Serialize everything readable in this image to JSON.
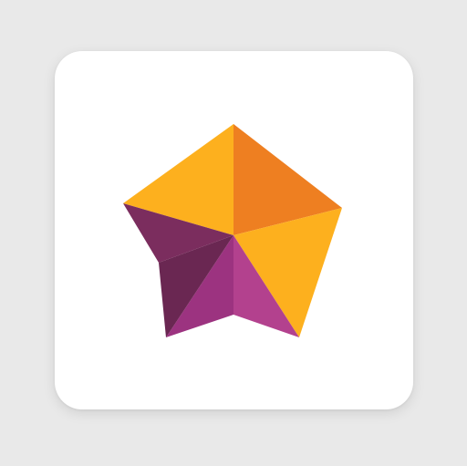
{
  "app_icon": {
    "icon": "star-logo",
    "colors": {
      "background": "#e9e9e9",
      "tile": "#ffffff",
      "orange_light": "#fdb01e",
      "orange": "#f3a019",
      "orange_dark": "#ee7f21",
      "magenta": "#b3418e",
      "magenta_dark": "#9c3380",
      "plum": "#7b2d5e",
      "plum_dark": "#6a2752"
    }
  }
}
